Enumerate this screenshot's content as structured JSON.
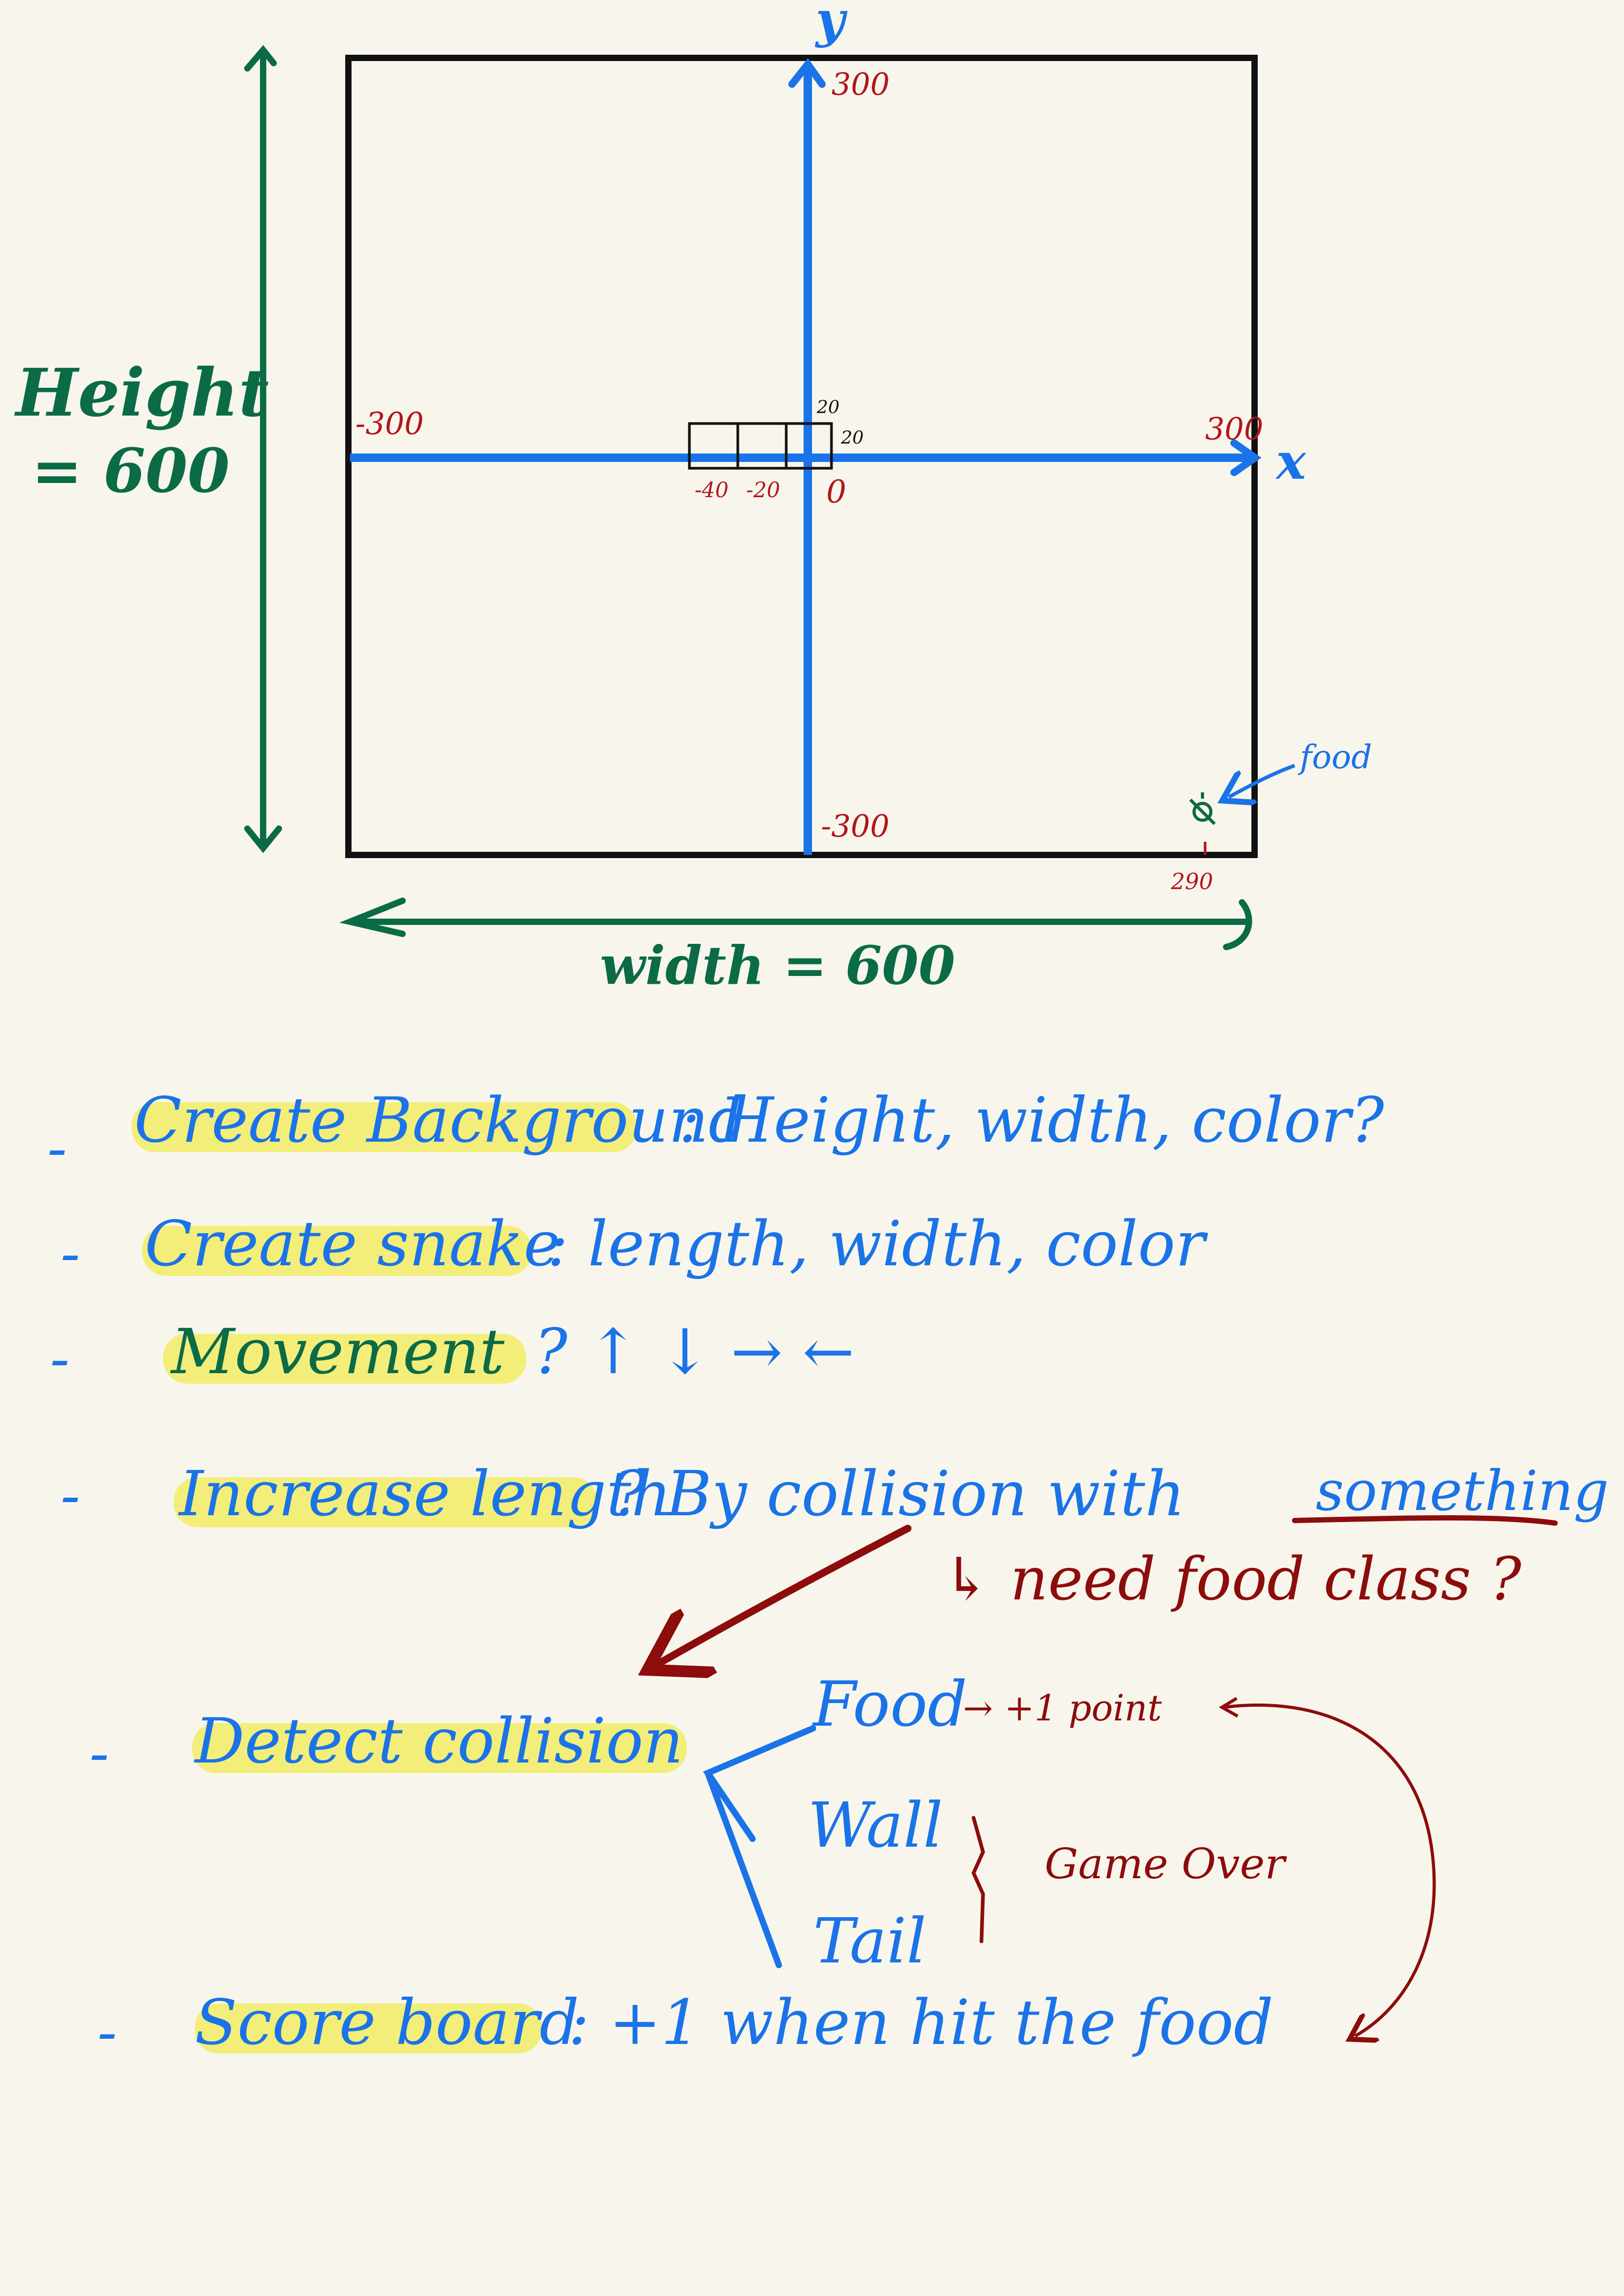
{
  "diagram": {
    "height_label": {
      "line1": "Height",
      "line2": "= 600"
    },
    "width_label": "width = 600",
    "axis_y_label": "y",
    "axis_x_label": "x",
    "y_top": "300",
    "y_bottom": "-300",
    "x_left": "-300",
    "x_right": "300",
    "origin": "0",
    "seg_neg40": "-40",
    "seg_neg20": "-20",
    "seg_20_top": "20",
    "seg_20_side": "20",
    "food_label": "food",
    "food_coord": "290"
  },
  "notes": {
    "dashes": [
      "-",
      "-",
      "-",
      "-",
      "-",
      "-"
    ],
    "background": {
      "highlight": "Create Background",
      "rest": ": Height, width, color?"
    },
    "snake": {
      "highlight": "Create snake",
      "rest": ": length, width, color"
    },
    "movement": {
      "highlight": "Movement",
      "rest": "? ↑ ↓ → ←"
    },
    "increase": {
      "highlight": "Increase length",
      "rest": "? By collision with",
      "underline": "something"
    },
    "food_class": "↳ need food class ?",
    "detect": "Detect collision",
    "branches": [
      "Food",
      "Wall",
      "Tail"
    ],
    "point": "→ +1 point",
    "game_over": "Game Over",
    "score": {
      "highlight": "Score board",
      "rest": ": +1 when hit the food"
    }
  },
  "colors": {
    "green": "#0b6b47",
    "blue": "#1a73e8",
    "red": "#b3151b",
    "dark_red": "#8d0c0c",
    "highlight": "#f3ee7a",
    "paper": "#f8f6ec"
  }
}
